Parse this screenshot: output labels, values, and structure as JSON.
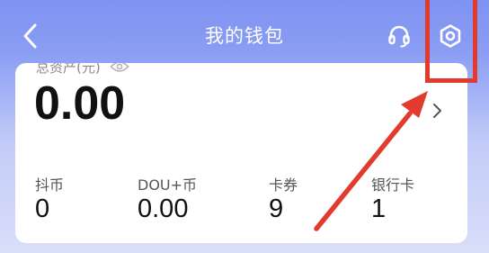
{
  "nav": {
    "title": "我的钱包",
    "back_icon": "chevron-left-icon",
    "service_icon": "headset-icon",
    "settings_icon": "gear-icon"
  },
  "wallet": {
    "asset_label": "总资产(元)",
    "asset_total": "0.00",
    "visibility_icon": "eye-icon",
    "detail_icon": "chevron-right-icon",
    "stats": [
      {
        "label": "抖币",
        "value": "0"
      },
      {
        "label": "DOU+币",
        "value": "0.00"
      },
      {
        "label": "卡券",
        "value": "9"
      },
      {
        "label": "银行卡",
        "value": "1"
      }
    ]
  },
  "annotation": {
    "color": "#e23b2e",
    "highlight": "settings-button"
  },
  "colors": {
    "header": "#7e92f2",
    "card": "#ffffff",
    "text_primary": "#111111",
    "text_secondary": "#8a8a8a"
  }
}
